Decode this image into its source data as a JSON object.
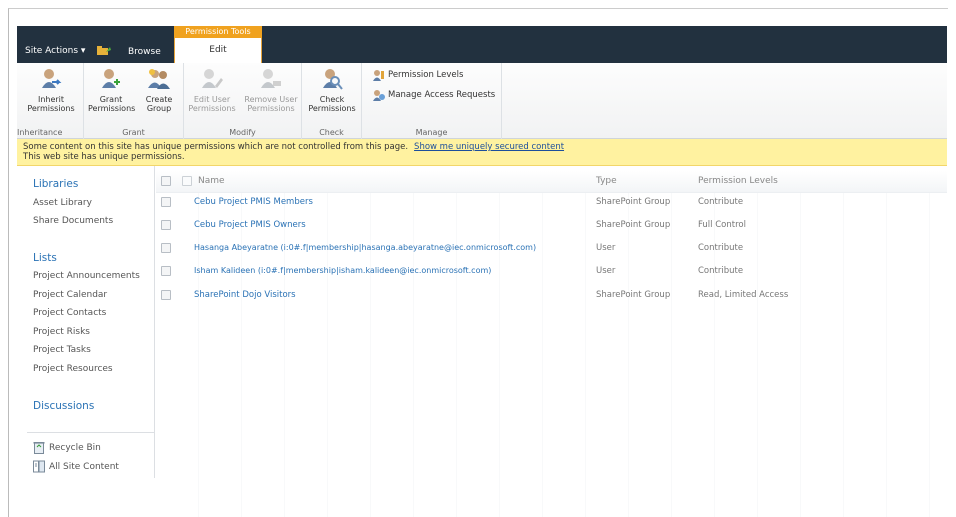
{
  "topbar": {
    "site_actions": "Site Actions ▾",
    "browse": "Browse",
    "context_tab": "Permission Tools",
    "edit_tab": "Edit"
  },
  "ribbon": {
    "groups": {
      "inheritance": "Inheritance",
      "grant": "Grant",
      "modify": "Modify",
      "check": "Check",
      "manage": "Manage"
    },
    "buttons": {
      "inherit_1": "Inherit",
      "inherit_2": "Permissions",
      "grant_1": "Grant",
      "grant_2": "Permissions",
      "create_1": "Create",
      "create_2": "Group",
      "edit_user_1": "Edit User",
      "edit_user_2": "Permissions",
      "remove_user_1": "Remove User",
      "remove_user_2": "Permissions",
      "check_1": "Check",
      "check_2": "Permissions",
      "permission_levels": "Permission Levels",
      "manage_access": "Manage Access Requests"
    }
  },
  "warning": {
    "line1": "Some content on this site has unique permissions which are not controlled from this page.",
    "link": "Show me uniquely secured content",
    "line2": "This web site has unique permissions."
  },
  "leftnav": {
    "libraries": "Libraries",
    "library_items": [
      "Asset Library",
      "Share Documents"
    ],
    "lists": "Lists",
    "list_items": [
      "Project Announcements",
      "Project Calendar",
      "Project Contacts",
      "Project Risks",
      "Project Tasks",
      "Project Resources"
    ],
    "discussions": "Discussions",
    "recycle_bin": "Recycle Bin",
    "all_site_content": "All Site Content"
  },
  "table": {
    "headers": {
      "name": "Name",
      "type": "Type",
      "permission_levels": "Permission Levels"
    },
    "rows": [
      {
        "name": "Cebu Project PMIS Members",
        "type": "SharePoint Group",
        "perm": "Contribute"
      },
      {
        "name": "Cebu Project PMIS Owners",
        "type": "SharePoint Group",
        "perm": "Full Control"
      },
      {
        "name": "Hasanga Abeyaratne (i:0#.f|membership|hasanga.abeyaratne@iec.onmicrosoft.com)",
        "type": "User",
        "perm": "Contribute"
      },
      {
        "name": "Isham Kalideen (i:0#.f|membership|isham.kalideen@iec.onmicrosoft.com)",
        "type": "User",
        "perm": "Contribute"
      },
      {
        "name": "SharePoint Dojo Visitors",
        "type": "SharePoint Group",
        "perm": "Read, Limited Access"
      }
    ]
  },
  "colors": {
    "topbar": "#22313f",
    "context_tab": "#f0a21f",
    "link": "#2a72b5",
    "warning_bg": "#fff2a0"
  }
}
